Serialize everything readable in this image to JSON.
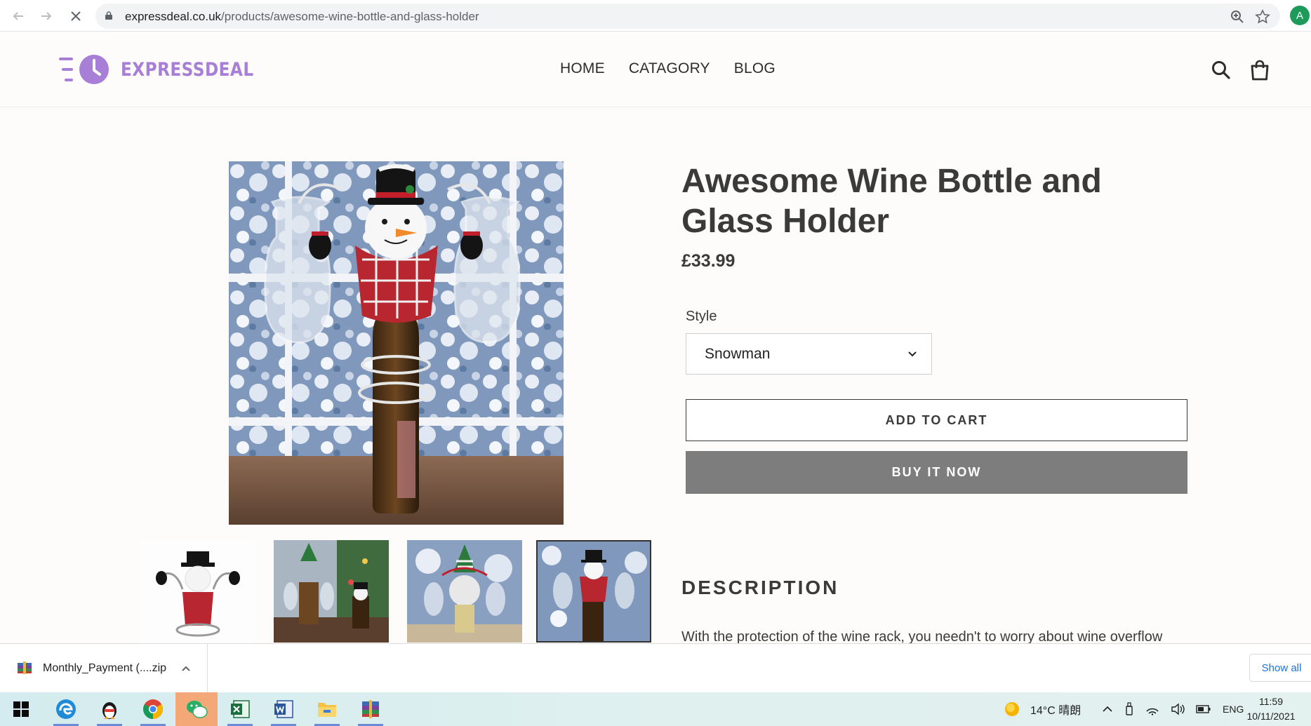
{
  "browser": {
    "url_domain": "expressdeal.co.uk",
    "url_path": "/products/awesome-wine-bottle-and-glass-holder",
    "profile_initial": "A"
  },
  "site": {
    "logo_text": "EXPRESSDEAL",
    "nav": [
      "HOME",
      "CATAGORY",
      "BLOG"
    ]
  },
  "product": {
    "title": "Awesome Wine Bottle and Glass Holder",
    "price": "£33.99",
    "style_label": "Style",
    "style_selected": "Snowman",
    "add_to_cart": "ADD TO CART",
    "buy_now": "BUY IT NOW",
    "description_heading": "DESCRIPTION",
    "description_text": "With the protection of the wine rack, you needn't to worry about wine overflow"
  },
  "download_bar": {
    "file_name": "Monthly_Payment (....zip",
    "show_all": "Show all"
  },
  "taskbar": {
    "weather": "14°C 晴朗",
    "language": "ENG",
    "time": "11:59",
    "date": "10/11/2021"
  },
  "colors": {
    "brand": "#a77fd6",
    "buy_button": "#7d7d7d",
    "link": "#1a73e8"
  }
}
